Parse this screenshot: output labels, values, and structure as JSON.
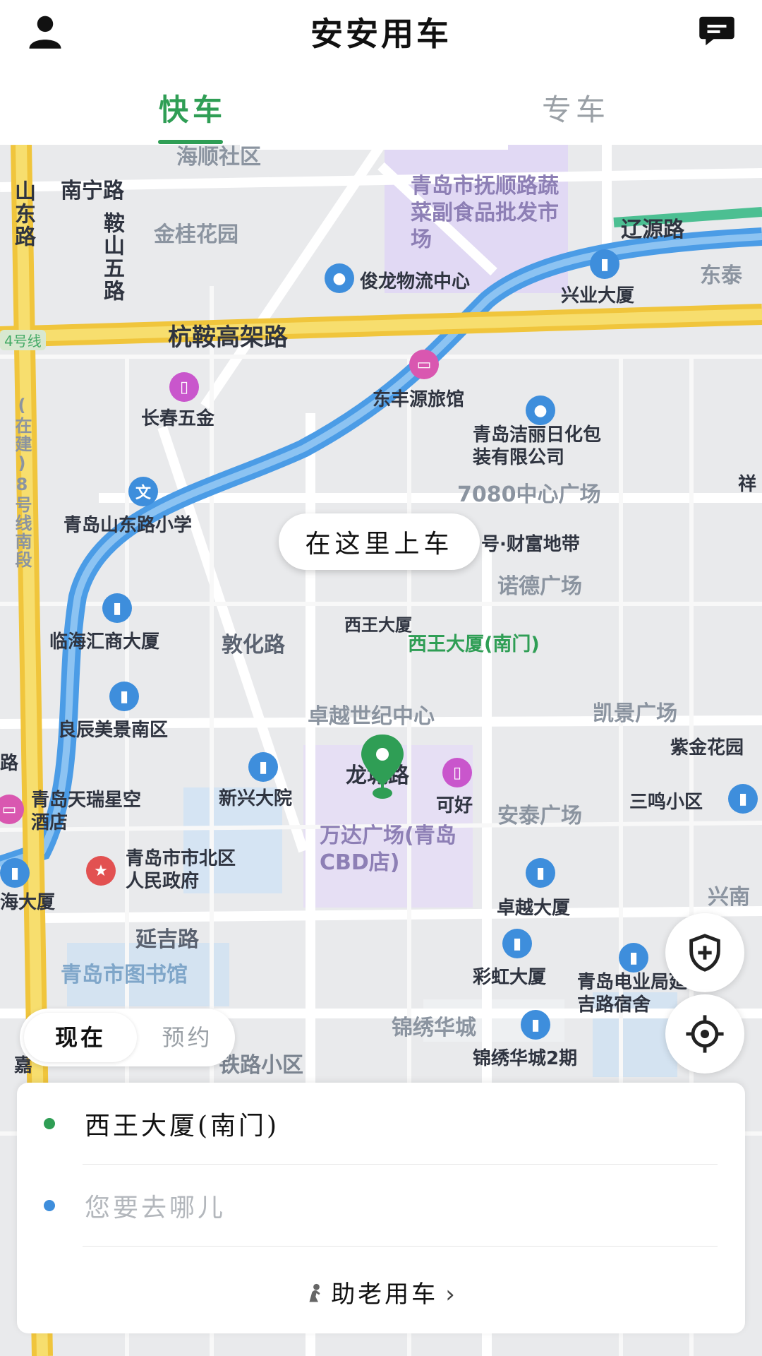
{
  "app": {
    "title": "安安用车"
  },
  "header": {
    "left_icon": "user-icon",
    "right_icon": "message-icon"
  },
  "tabs": [
    {
      "label": "快车",
      "active": true
    },
    {
      "label": "专车",
      "active": false
    }
  ],
  "colors": {
    "accent": "#2f9e55",
    "dest_dot": "#3e8edc"
  },
  "map": {
    "pickup_bubble": "在这里上车",
    "pickup_label": "西王大厦(南门)",
    "labels": {
      "haishun": "海顺社区",
      "nanning": "南宁路",
      "shandong": "山东路",
      "anshan": "鞍山五路",
      "jingui": "金桂花园",
      "market": "青岛市抚顺路蔬菜副食品批发市场",
      "liaoyuan": "辽源路",
      "junlong": "俊龙物流中心",
      "xingye": "兴业大厦",
      "dongtai": "东泰",
      "hangan": "杭鞍高架路",
      "line4": "4号线",
      "changchun": "长春五金",
      "dongfeng": "东丰源旅馆",
      "jieli": "青岛洁丽日化包装有限公司",
      "plaza7080": "7080中心广场",
      "xiang": "祥",
      "school": "青岛山东路小学",
      "line8": "(在建)8号线南段",
      "wealth": "号·财富地带",
      "nuode": "诺德广场",
      "linhai": "临海汇商大厦",
      "dunhua": "敦化路",
      "xiwang": "西王大厦",
      "zhuoyue_center": "卓越世纪中心",
      "kaijing": "凯景广场",
      "zijin": "紫金花园",
      "liangchen": "良辰美景南区",
      "road_left": "路",
      "longcheng": "龙城路",
      "xinxing": "新兴大院",
      "kehao": "可好",
      "sanming": "三鸣小区",
      "tianrui": "青岛天瑞星空酒店",
      "wanda": "万达广场(青岛CBD店)",
      "antai": "安泰广场",
      "government": "青岛市市北区人民政府",
      "haidasha": "海大厦",
      "zhuoyue_tower": "卓越大厦",
      "xingnan": "兴南",
      "yanji": "延吉路",
      "library": "青岛市图书馆",
      "caihong": "彩虹大厦",
      "dianye": "青岛电业局延吉路宿舍",
      "jinxiu": "锦绣华城",
      "jinxiu2": "锦绣华城2期",
      "tielu": "铁路小区",
      "jia": "嘉"
    }
  },
  "ride_mode": {
    "now": "现在",
    "reserve": "预约"
  },
  "card": {
    "origin": "西王大厦(南门)",
    "destination_placeholder": "您要去哪儿",
    "elder_mode": "助老用车",
    "elder_icon": "elder-icon",
    "chevron": "›"
  },
  "fabs": {
    "safety_icon": "shield-plus-icon",
    "locate_icon": "locate-icon"
  }
}
